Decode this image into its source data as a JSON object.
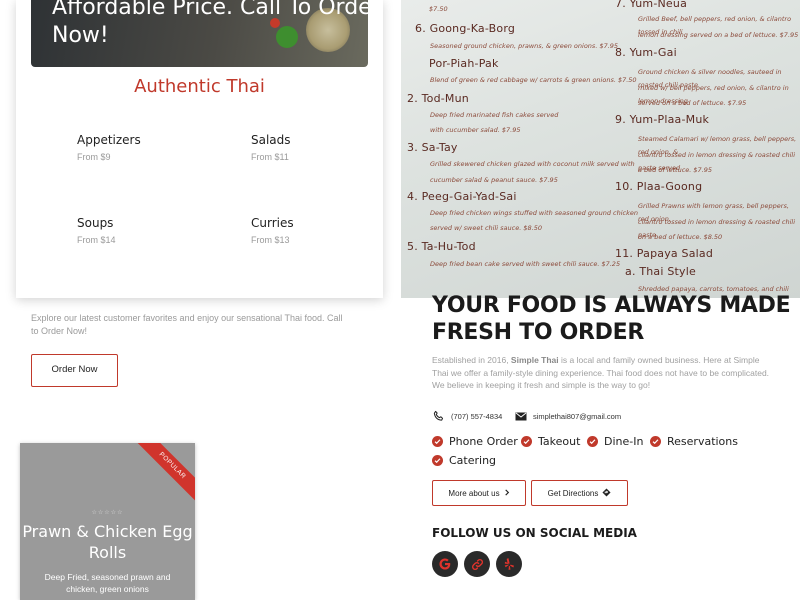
{
  "promo": {
    "hero_line1": "Affordable Price. Call To Order",
    "hero_line2": "Now!",
    "title": "Authentic Thai",
    "categories": [
      {
        "name": "Appetizers",
        "price": "From $9"
      },
      {
        "name": "Salads",
        "price": "From $11"
      },
      {
        "name": "Soups",
        "price": "From $14"
      },
      {
        "name": "Curries",
        "price": "From $13"
      }
    ]
  },
  "menu_photo": {
    "left_items": [
      {
        "title": "$7.50",
        "desc": []
      },
      {
        "title": "6. Goong-Ka-Borg",
        "desc": [
          "Seasoned ground chicken, prawns, & green onions. $7.95"
        ]
      },
      {
        "title": "Por-Piah-Pak",
        "desc": [
          "Blend of green & red cabbage w/ carrots & green onions. $7.50"
        ]
      },
      {
        "title": "2. Tod-Mun",
        "desc": [
          "Deep fried marinated fish cakes served",
          "with cucumber salad. $7.95"
        ]
      },
      {
        "title": "3. Sa-Tay",
        "desc": [
          "Grilled skewered chicken glazed with coconut milk served with",
          "cucumber salad & peanut sauce. $7.95"
        ]
      },
      {
        "title": "4. Peeg-Gai-Yad-Sai",
        "desc": [
          "Deep fried chicken wings stuffed with seasoned ground chicken",
          "served w/ sweet chili sauce. $8.50"
        ]
      },
      {
        "title": "5. Ta-Hu-Tod",
        "desc": [
          "Deep fried bean cake served with sweet chili sauce. $7.25"
        ]
      }
    ],
    "right_items": [
      {
        "title": "7. Yum-Neua",
        "desc": [
          "Grilled Beef, bell peppers, red onion, & cilantro tossed in chili",
          "lemon dressing served on a bed of lettuce. $7.95"
        ]
      },
      {
        "title": "8. Yum-Gai",
        "desc": [
          "Ground chicken & silver noodles, sauteed in roasted chili paste",
          "mixed w/ bell peppers, red onion, & cilantro in lemon dressing",
          "served on a bed of lettuce. $7.95"
        ]
      },
      {
        "title": "9. Yum-Plaa-Muk",
        "desc": [
          "Steamed Calamari w/ lemon grass, bell peppers, red onion, &",
          "cilantro tossed in lemon dressing & roasted chili paste served",
          "a bed of lettuce. $7.95"
        ]
      },
      {
        "title": "10. Plaa-Goong",
        "desc": [
          "Grilled Prawns with lemon grass, bell peppers, red onion,",
          "cilantro tossed in lemon dressing & roasted chili paste",
          "on a bed of lettuce. $8.50"
        ]
      },
      {
        "title": "11. Papaya Salad",
        "desc": []
      },
      {
        "title": "a. Thai Style",
        "desc": [
          "Shredded papaya, carrots, tomatoes, and chili mixed with"
        ]
      }
    ]
  },
  "intro": {
    "text": "Explore our latest customer favorites and enjoy our sensational Thai food. Call to Order Now!",
    "order_button": "Order Now"
  },
  "featured": {
    "badge": "POPULAR",
    "stars": "☆☆☆☆☆",
    "title": "Prawn & Chicken Egg Rolls",
    "description": "Deep Fried, seasoned prawn and chicken, green onions"
  },
  "about": {
    "headline": "YOUR FOOD IS ALWAYS MADE FRESH TO ORDER",
    "text_before": "Established in 2016, ",
    "brand": "Simple Thai",
    "text_after": " is a local and family owned business. Here at Simple Thai we offer a family-style dining experience. Thai food does not have to be complicated. We believe in keeping it fresh and simple is the way to go!",
    "phone": "(707) 557-4834",
    "email": "simplethai807@gmail.com",
    "services": [
      "Phone Order",
      "Takeout",
      "Dine-In",
      "Reservations",
      "Catering"
    ],
    "more_button": "More about us",
    "directions_button": "Get Directions",
    "follow_title": "FOLLOW US ON SOCIAL MEDIA",
    "social_icons": [
      "google-icon",
      "link-icon",
      "yelp-icon"
    ],
    "accent_color": "#c0392b"
  }
}
